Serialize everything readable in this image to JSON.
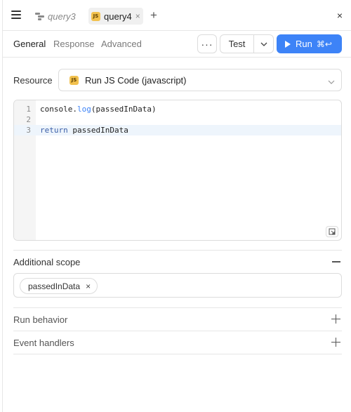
{
  "tabs": [
    {
      "label": "query3",
      "icon": "query-icon",
      "active": false
    },
    {
      "label": "query4",
      "icon": "js-badge",
      "badge": "JS",
      "active": true
    }
  ],
  "tab_close_glyph": "×",
  "add_tab_glyph": "+",
  "close_panel_glyph": "×",
  "subtabs": [
    "General",
    "Response",
    "Advanced"
  ],
  "more_label": "···",
  "test_label": "Test",
  "run_label": "Run",
  "run_shortcut": "⌘↩",
  "resource": {
    "label": "Resource",
    "badge": "JS",
    "value": "Run JS Code (javascript)"
  },
  "editor": {
    "lines": [
      {
        "num": "1",
        "code": "console.log(passedInData)"
      },
      {
        "num": "2",
        "code": ""
      },
      {
        "num": "3",
        "code": "return passedInData"
      }
    ]
  },
  "sections": {
    "additional_scope": "Additional scope",
    "scope_chip": "passedInData",
    "scope_chip_remove": "×",
    "run_behavior": "Run behavior",
    "event_handlers": "Event handlers"
  },
  "colors": {
    "accent": "#3d83f7",
    "js_badge": "#f2c14e"
  }
}
